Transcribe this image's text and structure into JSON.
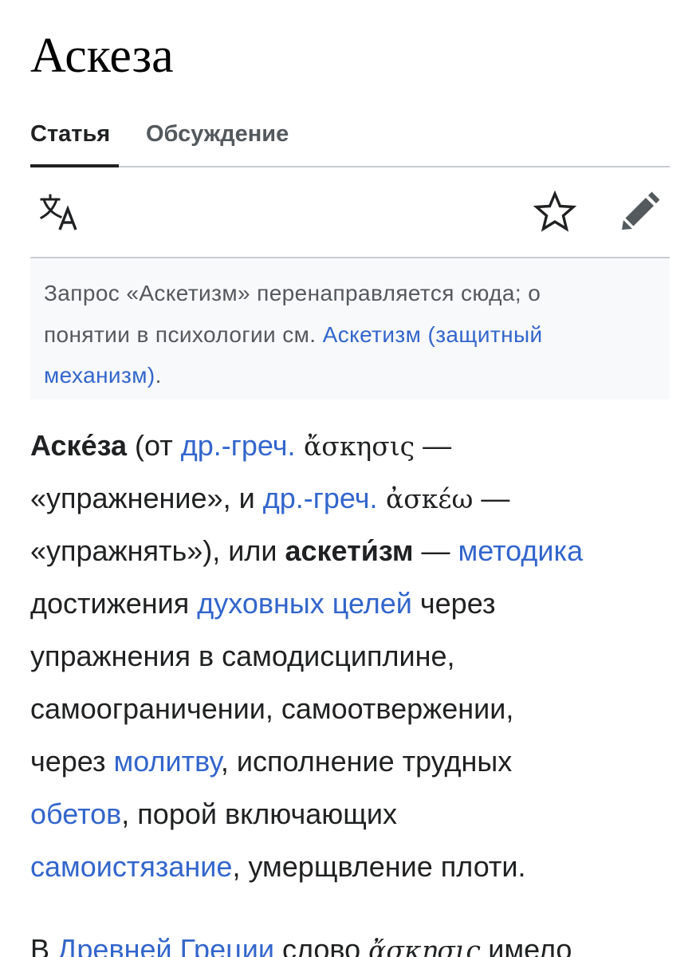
{
  "page": {
    "title": "Аскеза"
  },
  "tabs": [
    {
      "label": "Статья",
      "active": true
    },
    {
      "label": "Обсуждение",
      "active": false
    }
  ],
  "toolbar": {
    "language_icon": "language-icon",
    "watch_icon": "star-icon",
    "edit_icon": "pencil-icon"
  },
  "hatnote": {
    "line1": "Запрос «Аскетизм» перенаправляется сюда; о",
    "line2_text": "понятии в психологии см. ",
    "line2_link": "Аскетизм (защитный",
    "line3_link": "механизм)",
    "line3_end": "."
  },
  "article": {
    "l1": {
      "bold": "Аске́за",
      "t1": " (от ",
      "link1": "др.-греч.",
      "greek": " ἄσκησις",
      "t2": " —"
    },
    "l2": {
      "t1": "«упражнение», и ",
      "link1": "др.-греч.",
      "greek": " ἀσκέω",
      "t2": " —"
    },
    "l3": {
      "t1": "«упражнять»), или ",
      "bold": "аскети́зм",
      "t2": " — ",
      "link1": "методика"
    },
    "l4": {
      "t1": "достижения ",
      "link1": "духовных целей",
      "t2": " через"
    },
    "l5": {
      "t1": "упражнения в самодисциплине,"
    },
    "l6": {
      "t1": "самоограничении, самоотвержении,"
    },
    "l7": {
      "t1": "через ",
      "link1": "молитву",
      "t2": ", исполнение трудных"
    },
    "l8": {
      "link1": "обетов",
      "t1": ", порой включающих"
    },
    "l9": {
      "link1": "самоистязание",
      "t1": ", умерщвление плоти."
    },
    "p2": {
      "t1": "В ",
      "link1": "Древней Греции",
      "t2": " слово ",
      "greek": "ἄσκησις",
      "t3": " имело"
    }
  },
  "colors": {
    "link": "#3366cc",
    "text": "#202122",
    "muted": "#54595d",
    "hatnote_bg": "#f8f9fa",
    "border": "#c8ccd1"
  }
}
